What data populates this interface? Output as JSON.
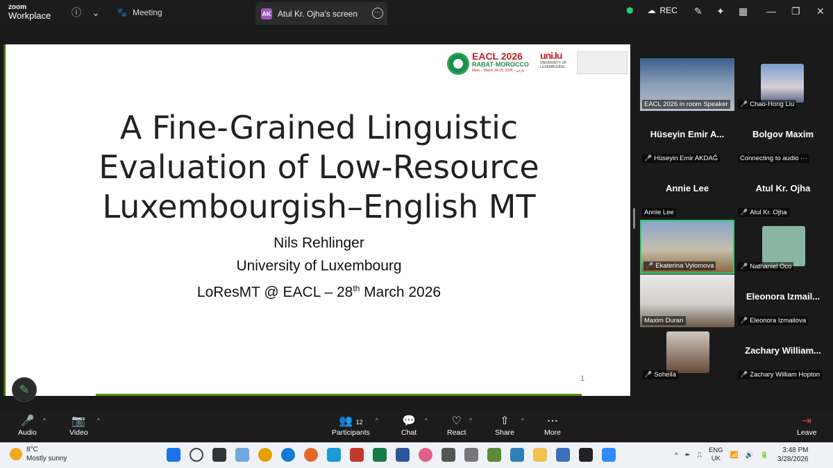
{
  "titlebar": {
    "logo_line1": "zoom",
    "logo_line2": "Workplace",
    "meeting_tab": "Meeting",
    "screen_tab_initials": "AK",
    "screen_tab_label": "Atul Kr. Ojha's screen",
    "rec_label": "REC"
  },
  "slide": {
    "title_lines": [
      "A Fine-Grained Linguistic",
      "Evaluation of Low-Resource",
      "Luxembourgish–English MT"
    ],
    "author": "Nils Rehlinger",
    "affiliation": "University of Luxembourg",
    "venue_prefix": "LoResMT @ EACL – 28",
    "venue_sup": "th",
    "venue_suffix": " March 2026",
    "page_number": "1",
    "eacl_logo_text": "EACL 2026",
    "eacl_logo_sub": "RABAT·MOROCCO",
    "eacl_logo_date": "Mars – March 24-29, 2026 · مارس",
    "uni_logo_mark": "uni.lu",
    "uni_logo_name": "UNIVERSITY OF LUXEMBOURG"
  },
  "participants": [
    {
      "name": "EACL 2026 in room Speaker",
      "big": "",
      "muted": false,
      "video": true
    },
    {
      "name": "Chao-Hong Liu",
      "big": "",
      "muted": true,
      "video": true
    },
    {
      "name": "Hüseyin Emir AKDAĞ",
      "big": "Hüseyin Emir A...",
      "muted": true,
      "video": false
    },
    {
      "name": "Connecting to audio ···",
      "big": "Bolgov Maxim",
      "muted": false,
      "video": false
    },
    {
      "name": "Annie Lee",
      "big": "Annie Lee",
      "muted": false,
      "video": false
    },
    {
      "name": "Atul Kr. Ojha",
      "big": "Atul Kr. Ojha",
      "muted": true,
      "video": false
    },
    {
      "name": "Ekaterina Vylomova",
      "big": "",
      "muted": true,
      "video": true
    },
    {
      "name": "Nathaniel Oco",
      "big": "",
      "muted": true,
      "video": true
    },
    {
      "name": "Maxim Duran",
      "big": "",
      "muted": false,
      "video": true
    },
    {
      "name": "Eleonora Izmailova",
      "big": "Eleonora  Izmail...",
      "muted": true,
      "video": false
    },
    {
      "name": "Soheila",
      "big": "",
      "muted": true,
      "video": true
    },
    {
      "name": "Zachary William Hopton",
      "big": "Zachary  William...",
      "muted": true,
      "video": false
    }
  ],
  "controls": {
    "audio": "Audio",
    "video": "Video",
    "participants": "Participants",
    "participants_count": "12",
    "chat": "Chat",
    "react": "React",
    "share": "Share",
    "more": "More",
    "leave": "Leave"
  },
  "taskbar": {
    "temp": "8°C",
    "weather": "Mostly sunny",
    "lang1": "ENG",
    "lang2": "UK",
    "time": "3:48 PM",
    "date": "3/28/2026"
  }
}
